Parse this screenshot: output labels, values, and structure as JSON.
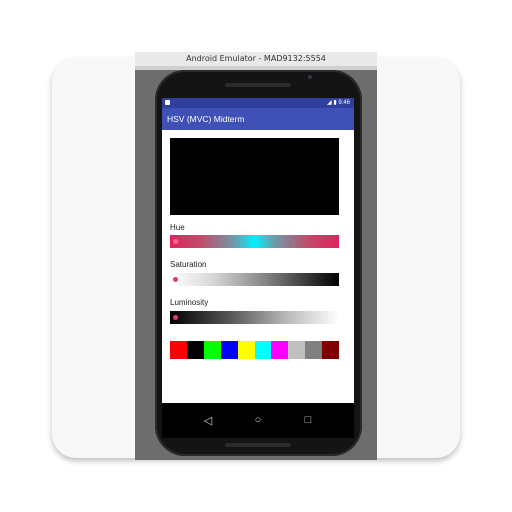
{
  "emulator": {
    "title": "Android Emulator - MAD9132:5554"
  },
  "statusbar": {
    "time": "9:46"
  },
  "app": {
    "title": "HSV (MVC) Midterm"
  },
  "sliders": [
    {
      "label": "Hue",
      "value": 0
    },
    {
      "label": "Saturation",
      "value": 0
    },
    {
      "label": "Luminosity",
      "value": 0
    }
  ],
  "preview_color": "#000000",
  "swatches": [
    "#ff0000",
    "#000000",
    "#00ff00",
    "#0000ff",
    "#ffff00",
    "#00ffff",
    "#ff00ff",
    "#c0c0c0",
    "#808080",
    "#800000"
  ],
  "nav": {
    "back_icon": "◁",
    "home_icon": "○",
    "recents_icon": "□"
  },
  "colors": {
    "app_bar": "#3f51b5",
    "status_bar": "#2f3f9e",
    "accent": "#e53970"
  }
}
